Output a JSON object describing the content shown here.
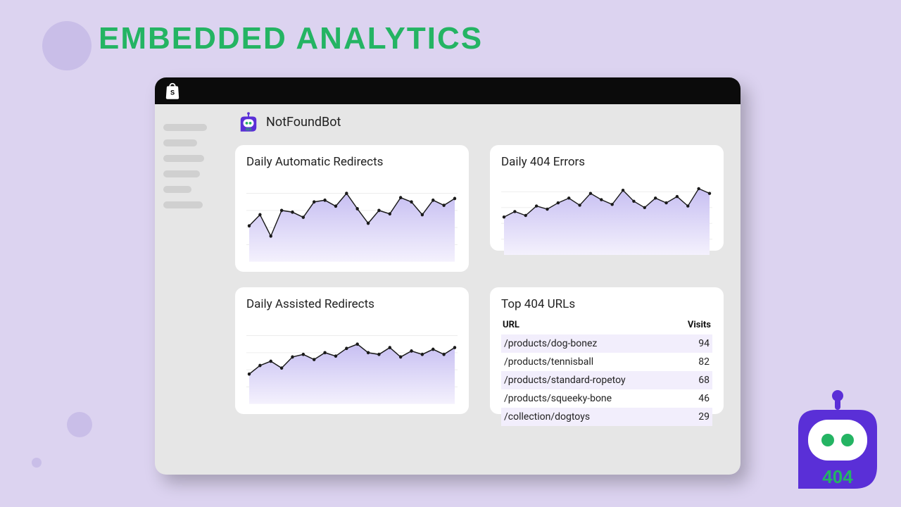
{
  "title": "EMBEDDED ANALYTICS",
  "app_name": "NotFoundBot",
  "cards": {
    "auto": "Daily Automatic Redirects",
    "errors": "Daily 404 Errors",
    "assisted": "Daily Assisted Redirects",
    "top_urls_title": "Top 404 URLs"
  },
  "table": {
    "url_hdr": "URL",
    "visits_hdr": "Visits",
    "rows": [
      {
        "url": "/products/dog-bonez",
        "visits": 94
      },
      {
        "url": "/products/tennisball",
        "visits": 82
      },
      {
        "url": "/products/standard-ropetoy",
        "visits": 68
      },
      {
        "url": "/products/squeeky-bone",
        "visits": 46
      },
      {
        "url": "/collection/dogtoys",
        "visits": 29
      }
    ]
  },
  "big_bot_label": "404",
  "chart_data": [
    {
      "type": "area",
      "title": "Daily Automatic Redirects",
      "xlabel": "",
      "ylabel": "",
      "ylim": [
        0,
        100
      ],
      "values": [
        42,
        55,
        30,
        60,
        58,
        52,
        70,
        72,
        65,
        80,
        62,
        45,
        60,
        56,
        75,
        70,
        55,
        72,
        66,
        74
      ]
    },
    {
      "type": "area",
      "title": "Daily 404 Errors",
      "xlabel": "",
      "ylabel": "",
      "ylim": [
        0,
        100
      ],
      "values": [
        48,
        55,
        50,
        62,
        58,
        66,
        72,
        63,
        78,
        70,
        64,
        82,
        68,
        60,
        72,
        66,
        74,
        62,
        84,
        78
      ]
    },
    {
      "type": "area",
      "title": "Daily Assisted Redirects",
      "xlabel": "",
      "ylabel": "",
      "ylim": [
        0,
        100
      ],
      "values": [
        35,
        45,
        50,
        42,
        55,
        58,
        52,
        60,
        56,
        65,
        70,
        60,
        58,
        66,
        55,
        62,
        58,
        64,
        58,
        66
      ]
    }
  ],
  "colors": {
    "chart_fill_top": "#C7BFF2",
    "chart_fill_bottom": "#F4F1FD",
    "chart_stroke": "#1A1A1A",
    "brand_purple": "#5A2FD7",
    "brand_green": "#24B463"
  }
}
